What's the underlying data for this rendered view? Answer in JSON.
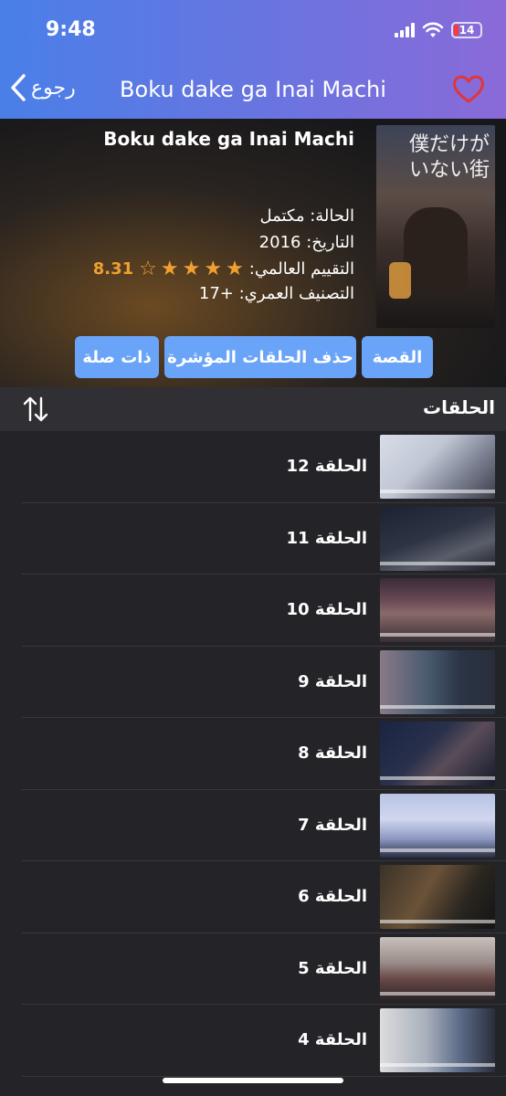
{
  "status": {
    "time": "9:48",
    "battery": "14"
  },
  "nav": {
    "back_label": "رجوع",
    "title": "Boku dake ga Inai Machi"
  },
  "anime": {
    "title": "Boku dake ga Inai Machi",
    "poster_text": "僕だけが\nいない街",
    "status_line": "الحالة: مكتمل",
    "date_line": "التاريخ: 2016",
    "rating_label": "التقييم العالمي:",
    "rating_value": "8.31",
    "rating_stars": 4,
    "age_line": "التصنيف العمري: +17"
  },
  "buttons": {
    "story": "القصة",
    "delete_marked": "حذف الحلقات المؤشرة",
    "related": "ذات صلة"
  },
  "episodes_header": {
    "title": "الحلقات"
  },
  "episodes": [
    {
      "label": "الحلقة 12"
    },
    {
      "label": "الحلقة 11"
    },
    {
      "label": "الحلقة 10"
    },
    {
      "label": "الحلقة 9"
    },
    {
      "label": "الحلقة 8"
    },
    {
      "label": "الحلقة 7"
    },
    {
      "label": "الحلقة 6"
    },
    {
      "label": "الحلقة 5"
    },
    {
      "label": "الحلقة 4"
    }
  ],
  "colors": {
    "accent": "#6aa4f8",
    "star": "#f0a030",
    "heart": "#e0353b"
  }
}
